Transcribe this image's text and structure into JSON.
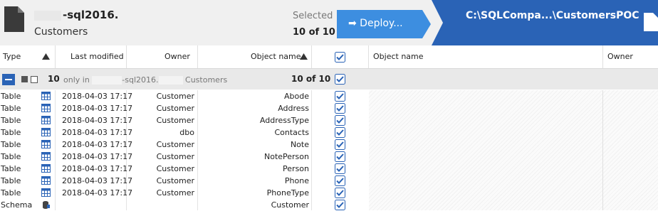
{
  "source": {
    "server": "-sql2016.",
    "database": "Customers"
  },
  "selection": {
    "label": "Selected",
    "value": "10 of 10"
  },
  "deploy": {
    "label": "➡ Deploy..."
  },
  "target": {
    "title": "C:\\SQLCompa...\\CustomersPOC"
  },
  "columns": {
    "type": "Type",
    "last_modified": "Last modified",
    "owner": "Owner",
    "object_name": "Object name",
    "target_object_name": "Object name",
    "target_owner": "Owner"
  },
  "group": {
    "count": "10",
    "desc_prefix": "only in",
    "desc_server": "-sql2016.",
    "desc_db": "Customers",
    "selected": "10 of 10"
  },
  "rows": [
    {
      "type": "Table",
      "icon": "table-icon",
      "modified": "2018-04-03 17:17",
      "owner": "Customer",
      "name": "Abode"
    },
    {
      "type": "Table",
      "icon": "table-icon",
      "modified": "2018-04-03 17:17",
      "owner": "Customer",
      "name": "Address"
    },
    {
      "type": "Table",
      "icon": "table-icon",
      "modified": "2018-04-03 17:17",
      "owner": "Customer",
      "name": "AddressType"
    },
    {
      "type": "Table",
      "icon": "table-icon",
      "modified": "2018-04-03 17:17",
      "owner": "dbo",
      "name": "Contacts"
    },
    {
      "type": "Table",
      "icon": "table-icon",
      "modified": "2018-04-03 17:17",
      "owner": "Customer",
      "name": "Note"
    },
    {
      "type": "Table",
      "icon": "table-icon",
      "modified": "2018-04-03 17:17",
      "owner": "Customer",
      "name": "NotePerson"
    },
    {
      "type": "Table",
      "icon": "table-icon",
      "modified": "2018-04-03 17:17",
      "owner": "Customer",
      "name": "Person"
    },
    {
      "type": "Table",
      "icon": "table-icon",
      "modified": "2018-04-03 17:17",
      "owner": "Customer",
      "name": "Phone"
    },
    {
      "type": "Table",
      "icon": "table-icon",
      "modified": "2018-04-03 17:17",
      "owner": "Customer",
      "name": "PhoneType"
    },
    {
      "type": "Schema",
      "icon": "schema-icon",
      "modified": "",
      "owner": "",
      "name": "Customer"
    }
  ],
  "colors": {
    "accent": "#2a63b6",
    "deploy": "#3d8ee0"
  }
}
